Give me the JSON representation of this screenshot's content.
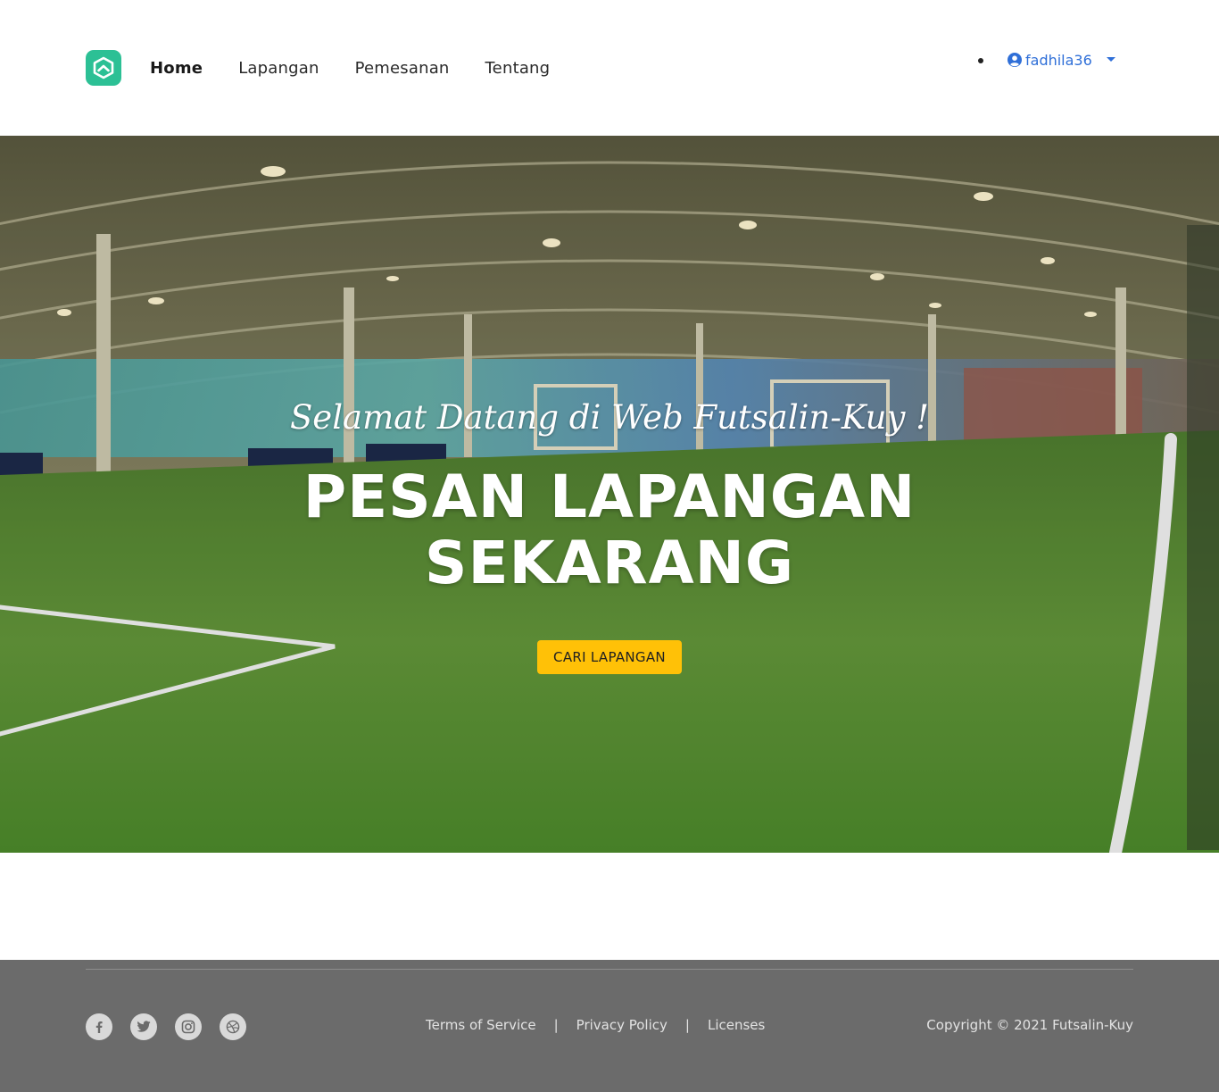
{
  "navbar": {
    "logo_icon": "hexagon-logo-icon",
    "brand_color": "#2cc095",
    "links": [
      {
        "label": "Home",
        "active": true
      },
      {
        "label": "Lapangan",
        "active": false
      },
      {
        "label": "Pemesanan",
        "active": false
      },
      {
        "label": "Tentang",
        "active": false
      }
    ],
    "user": {
      "username": "fadhila36",
      "icon": "user-circle-icon",
      "color": "#2f6fd8"
    }
  },
  "hero": {
    "subtitle": "Selamat Datang di Web Futsalin-Kuy !",
    "title_line1": "PESAN LAPANGAN",
    "title_line2": "SEKARANG",
    "cta_label": "CARI LAPANGAN",
    "cta_color": "#ffc107",
    "background": "indoor-futsal-field-photo"
  },
  "footer": {
    "socials": [
      {
        "name": "facebook-icon"
      },
      {
        "name": "twitter-icon"
      },
      {
        "name": "instagram-icon"
      },
      {
        "name": "dribbble-icon"
      }
    ],
    "links": [
      "Terms of Service",
      "Privacy Policy",
      "Licenses"
    ],
    "separator": "|",
    "copyright": "Copyright © 2021 Futsalin-Kuy",
    "background_color": "#6b6b6b"
  }
}
